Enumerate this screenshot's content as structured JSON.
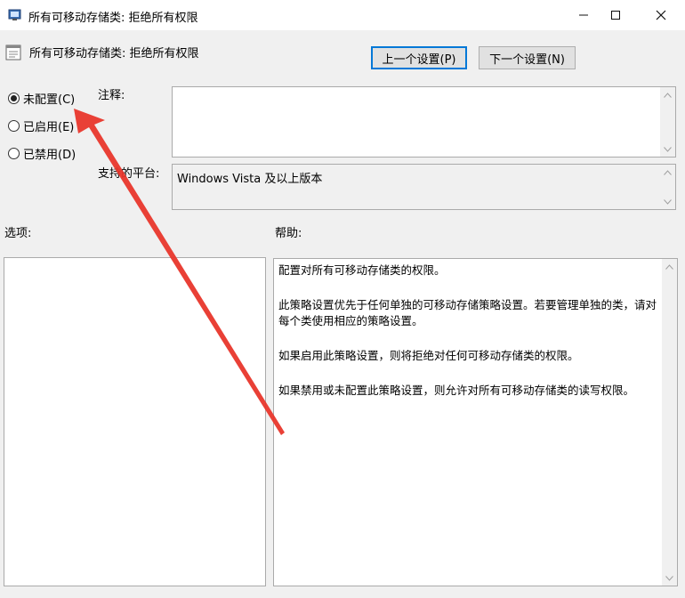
{
  "window": {
    "title": "所有可移动存储类: 拒绝所有权限"
  },
  "header": {
    "title": "所有可移动存储类: 拒绝所有权限",
    "prev_button": "上一个设置(P)",
    "next_button": "下一个设置(N)"
  },
  "state": {
    "options": [
      {
        "label": "未配置(C)",
        "checked": true
      },
      {
        "label": "已启用(E)",
        "checked": false
      },
      {
        "label": "已禁用(D)",
        "checked": false
      }
    ]
  },
  "comment": {
    "label": "注释:",
    "value": ""
  },
  "supported": {
    "label": "支持的平台:",
    "value": "Windows Vista 及以上版本"
  },
  "options_section": {
    "label": "选项:"
  },
  "help_section": {
    "label": "帮助:",
    "paragraphs": [
      "配置对所有可移动存储类的权限。",
      "此策略设置优先于任何单独的可移动存储策略设置。若要管理单独的类，请对每个类使用相应的策略设置。",
      "如果启用此策略设置，则将拒绝对任何可移动存储类的权限。",
      "如果禁用或未配置此策略设置，则允许对所有可移动存储类的读写权限。"
    ]
  },
  "colors": {
    "annotation_arrow": "#e8362b",
    "focus_border": "#0078d7"
  }
}
